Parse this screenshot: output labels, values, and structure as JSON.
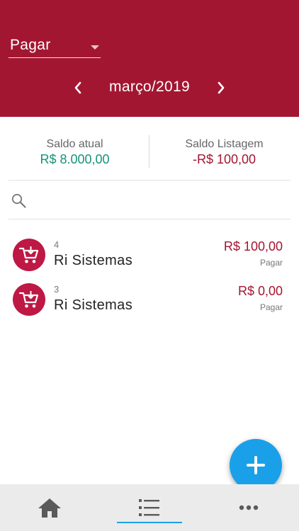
{
  "header": {
    "type_select": {
      "value": "Pagar"
    },
    "month": {
      "label": "março/2019"
    }
  },
  "balances": {
    "current": {
      "label": "Saldo atual",
      "value": "R$ 8.000,00"
    },
    "listing": {
      "label": "Saldo Listagem",
      "value": "-R$ 100,00"
    }
  },
  "search": {
    "placeholder": ""
  },
  "items": [
    {
      "number": "4",
      "name": "Ri Sistemas",
      "amount": "R$ 100,00",
      "status": "Pagar"
    },
    {
      "number": "3",
      "name": "Ri Sistemas",
      "amount": "R$ 0,00",
      "status": "Pagar"
    }
  ],
  "bottom_nav": {
    "tabs": [
      {
        "icon": "home-icon"
      },
      {
        "icon": "list-icon",
        "active": true
      },
      {
        "icon": "more-icon"
      }
    ]
  },
  "colors": {
    "brand": "#a31631",
    "avatar": "#be1845",
    "positive": "#16937a",
    "accent": "#1aa0e8"
  }
}
